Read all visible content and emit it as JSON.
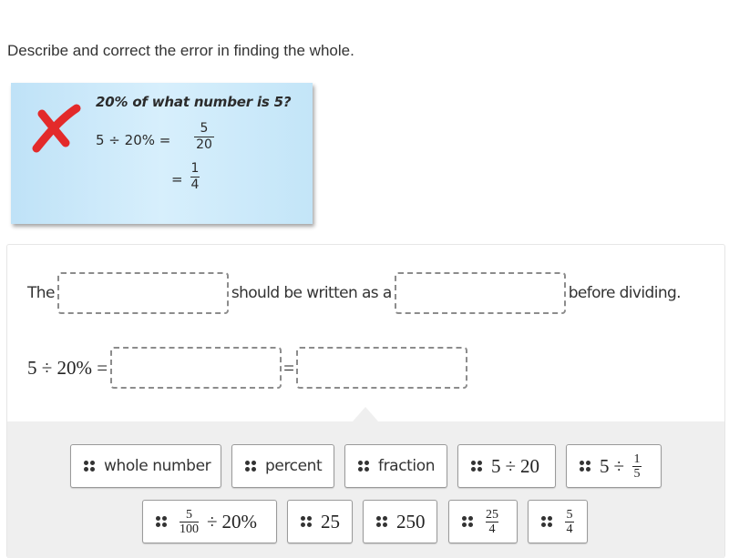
{
  "prompt": "Describe and correct the error in finding the whole.",
  "example": {
    "mark": "incorrect-x",
    "mark_color": "#e32a2a",
    "question": "20% of what number is 5?",
    "line1_lhs": "5 ÷ 20% =",
    "line1_num": "5",
    "line1_den": "20",
    "line2_lhs": "=",
    "line2_num": "1",
    "line2_den": "4"
  },
  "sentence": {
    "part1": "The",
    "part2": "should be written as a",
    "part3": "before dividing."
  },
  "equation": {
    "lhs": "5 ÷ 20% =",
    "mid": "="
  },
  "choices": [
    {
      "label": "whole number"
    },
    {
      "label": "percent"
    },
    {
      "label": "fraction"
    },
    {
      "label": "5 ÷ 20",
      "a": "5",
      "op": "÷",
      "b": "20"
    },
    {
      "label": "5 ÷ 1/5",
      "a": "5",
      "op": "÷",
      "num": "1",
      "den": "5"
    },
    {
      "label": "5/100 ÷ 20%",
      "num": "5",
      "den": "100",
      "op": "÷",
      "b": "20%"
    },
    {
      "label": "25"
    },
    {
      "label": "250"
    },
    {
      "label": "25/4",
      "num": "25",
      "den": "4"
    },
    {
      "label": "5/4",
      "num": "5",
      "den": "4"
    }
  ]
}
